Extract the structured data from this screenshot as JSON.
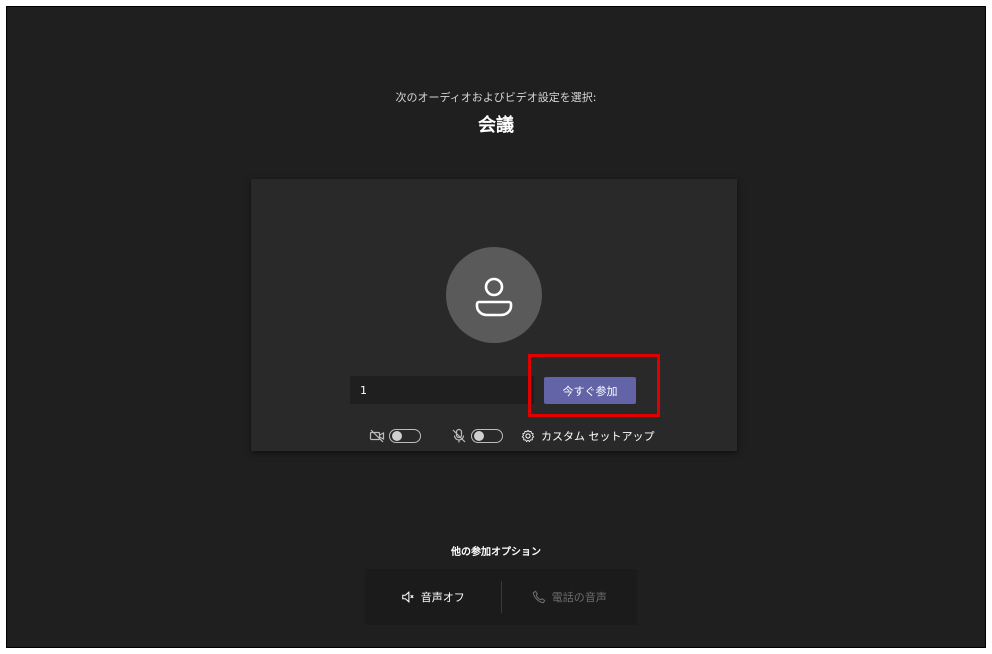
{
  "header": {
    "subtitle": "次のオーディオおよびビデオ設定を選択:",
    "title": "会議"
  },
  "prejoin": {
    "name_value": "1",
    "join_label": "今すぐ参加",
    "camera_toggle": "off",
    "mic_toggle": "off",
    "custom_setup_label": "カスタム セットアップ"
  },
  "other_options": {
    "title": "他の参加オプション",
    "audio_off_label": "音声オフ",
    "phone_audio_label": "電話の音声"
  },
  "colors": {
    "accent": "#6264a7",
    "highlight": "#e00000",
    "background": "#1f1f1f",
    "card": "#292929"
  },
  "icons": [
    "avatar-person-icon",
    "camera-off-icon",
    "mic-off-icon",
    "gear-icon",
    "speaker-muted-icon",
    "phone-icon"
  ]
}
